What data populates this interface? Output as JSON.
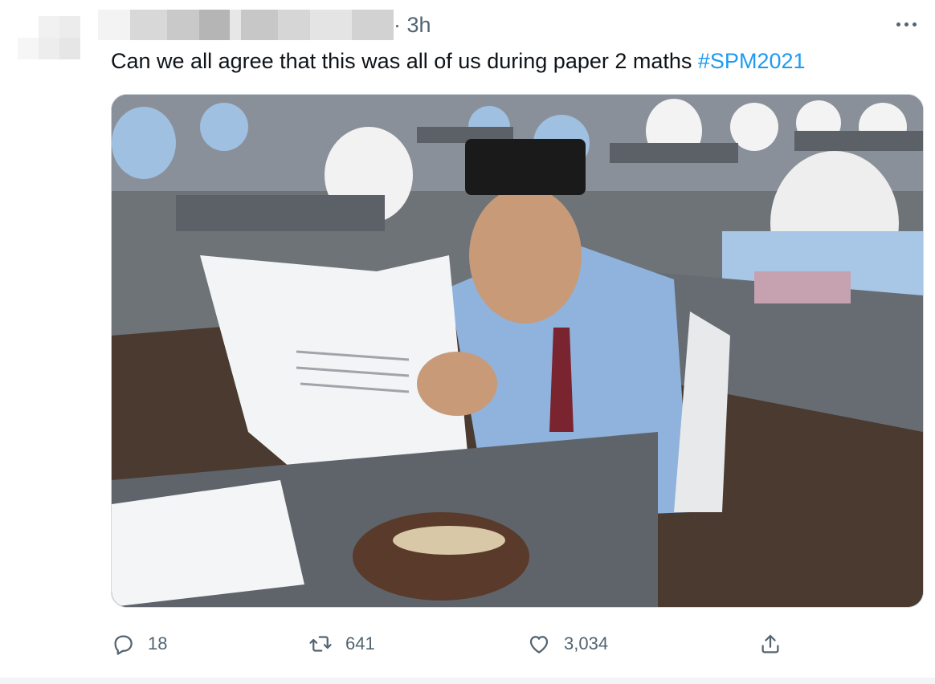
{
  "tweet": {
    "time_separator": "·",
    "timestamp": "3h",
    "text": "Can we all agree that this was all of us during paper 2 maths ",
    "hashtag": "#SPM2021"
  },
  "actions": {
    "reply_count": "18",
    "retweet_count": "641",
    "like_count": "3,034"
  },
  "icons": {
    "more": "more-horizontal-icon",
    "reply": "reply-bubble-icon",
    "retweet": "retweet-icon",
    "like": "heart-icon",
    "share": "share-upload-icon"
  },
  "colors": {
    "text": "#0f1419",
    "secondary": "#536471",
    "hashtag": "#1d9bf0",
    "border": "#cfd9de"
  }
}
